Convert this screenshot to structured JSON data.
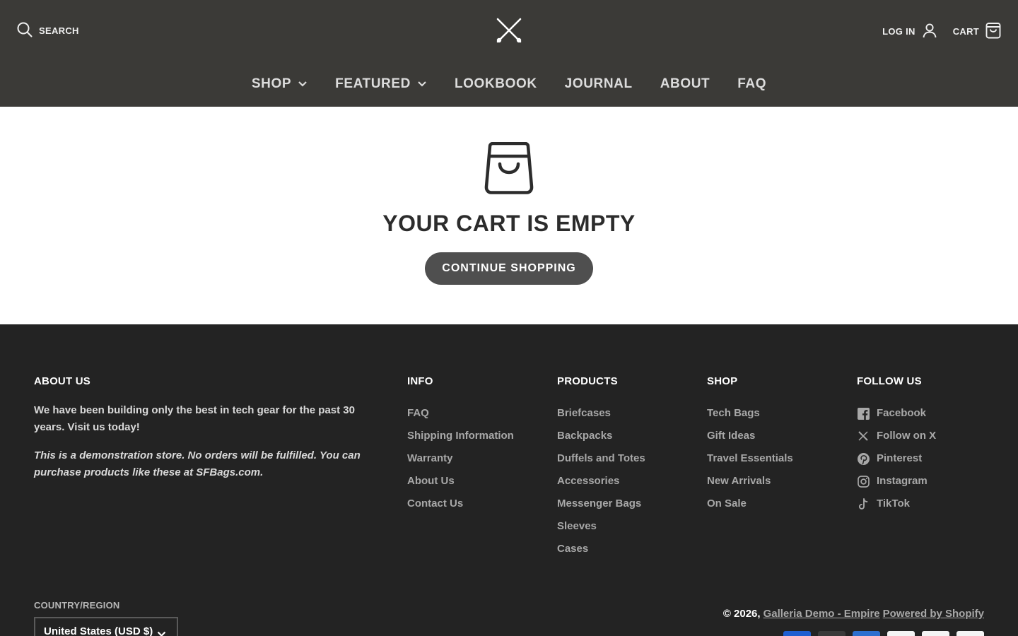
{
  "header": {
    "search_label": "SEARCH",
    "login_label": "LOG IN",
    "cart_label": "CART",
    "nav": [
      {
        "label": "SHOP",
        "has_dropdown": true
      },
      {
        "label": "FEATURED",
        "has_dropdown": true
      },
      {
        "label": "LOOKBOOK",
        "has_dropdown": false
      },
      {
        "label": "JOURNAL",
        "has_dropdown": false
      },
      {
        "label": "ABOUT",
        "has_dropdown": false
      },
      {
        "label": "FAQ",
        "has_dropdown": false
      }
    ]
  },
  "main": {
    "title": "YOUR CART IS EMPTY",
    "continue_label": "CONTINUE SHOPPING"
  },
  "footer": {
    "about": {
      "heading": "ABOUT US",
      "text": "We have been building only the best in tech gear for the past 30 years. Visit us today!",
      "note": "This is a demonstration store. No orders will be fulfilled.  You can purchase products like these at SFBags.com."
    },
    "info": {
      "heading": "INFO",
      "links": [
        "FAQ",
        "Shipping Information",
        "Warranty",
        "About Us",
        "Contact Us"
      ]
    },
    "products": {
      "heading": "PRODUCTS",
      "links": [
        "Briefcases",
        "Backpacks",
        "Duffels and Totes",
        "Accessories",
        "Messenger Bags",
        "Sleeves",
        "Cases"
      ]
    },
    "shop": {
      "heading": "SHOP",
      "links": [
        "Tech Bags",
        "Gift Ideas",
        "Travel Essentials",
        "New Arrivals",
        "On Sale"
      ]
    },
    "follow": {
      "heading": "FOLLOW US",
      "links": [
        {
          "label": "Facebook",
          "icon": "facebook-icon"
        },
        {
          "label": "Follow on X",
          "icon": "x-icon"
        },
        {
          "label": "Pinterest",
          "icon": "pinterest-icon"
        },
        {
          "label": "Instagram",
          "icon": "instagram-icon"
        },
        {
          "label": "TikTok",
          "icon": "tiktok-icon"
        }
      ]
    },
    "country_label": "COUNTRY/REGION",
    "country_value": "United States (USD $)",
    "copyright_prefix": "© 2026,",
    "store_link": "Galleria Demo - Empire",
    "powered_link": "Powered by Shopify",
    "payment_icons": [
      {
        "name": "amex-card-icon",
        "color": "#1f5fd1"
      },
      {
        "name": "mastercard-icon",
        "color": "#3a3a3a"
      },
      {
        "name": "american-express-icon",
        "color": "#2c6fcf"
      },
      {
        "name": "paypal-icon",
        "color": "#f4f4f4"
      },
      {
        "name": "diners-club-icon",
        "color": "#f4f4f4"
      },
      {
        "name": "visa-icon",
        "color": "#f4f4f4"
      }
    ]
  },
  "colors": {
    "header_bg": "#3b3a37",
    "footer_bg": "#232323",
    "button_bg": "#4f4f4f"
  }
}
